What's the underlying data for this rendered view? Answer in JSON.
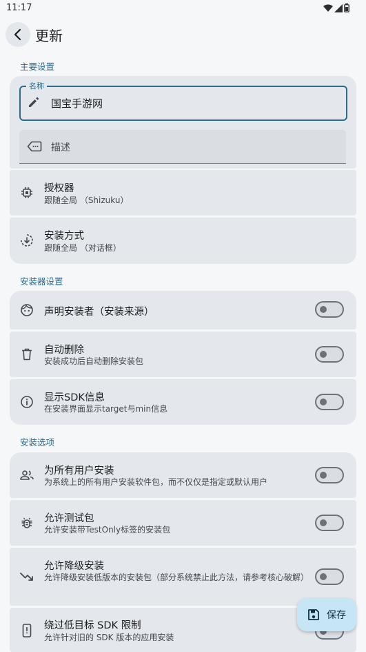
{
  "status": {
    "time": "11:17"
  },
  "header": {
    "title": "更新"
  },
  "sections": {
    "main": "主要设置",
    "installer": "安装器设置",
    "options": "安装选项"
  },
  "fields": {
    "name_label": "名称",
    "name_value": "国宝手游网",
    "desc_placeholder": "描述"
  },
  "main_rows": [
    {
      "title": "授权器",
      "subtitle": "跟随全局 （Shizuku）"
    },
    {
      "title": "安装方式",
      "subtitle": "跟随全局 （对话框）"
    }
  ],
  "installer_rows": [
    {
      "title": "声明安装者（安装来源）",
      "subtitle": "",
      "enabled": false
    },
    {
      "title": "自动删除",
      "subtitle": "安装成功后自动删除安装包",
      "enabled": false
    },
    {
      "title": "显示SDK信息",
      "subtitle": "在安装界面显示target与min信息",
      "enabled": false
    }
  ],
  "option_rows": [
    {
      "title": "为所有用户安装",
      "subtitle": "为系统上的所有用户安装软件包，而不仅仅是指定或默认用户",
      "enabled": false
    },
    {
      "title": "允许测试包",
      "subtitle": "允许安装带TestOnly标签的安装包",
      "enabled": false
    },
    {
      "title": "允许降级安装",
      "subtitle": "允许降级安装低版本的安装包（部分系统禁止此方法，请参考核心破解）",
      "enabled": false
    },
    {
      "title": "绕过低目标 SDK 限制",
      "subtitle": "允许针对旧的 SDK 版本的应用安装",
      "enabled": false
    }
  ],
  "fab": {
    "label": "保存"
  },
  "colors": {
    "accent": "#2a6b8c",
    "card": "#e4e8ec",
    "fab": "#c6e6f6"
  }
}
